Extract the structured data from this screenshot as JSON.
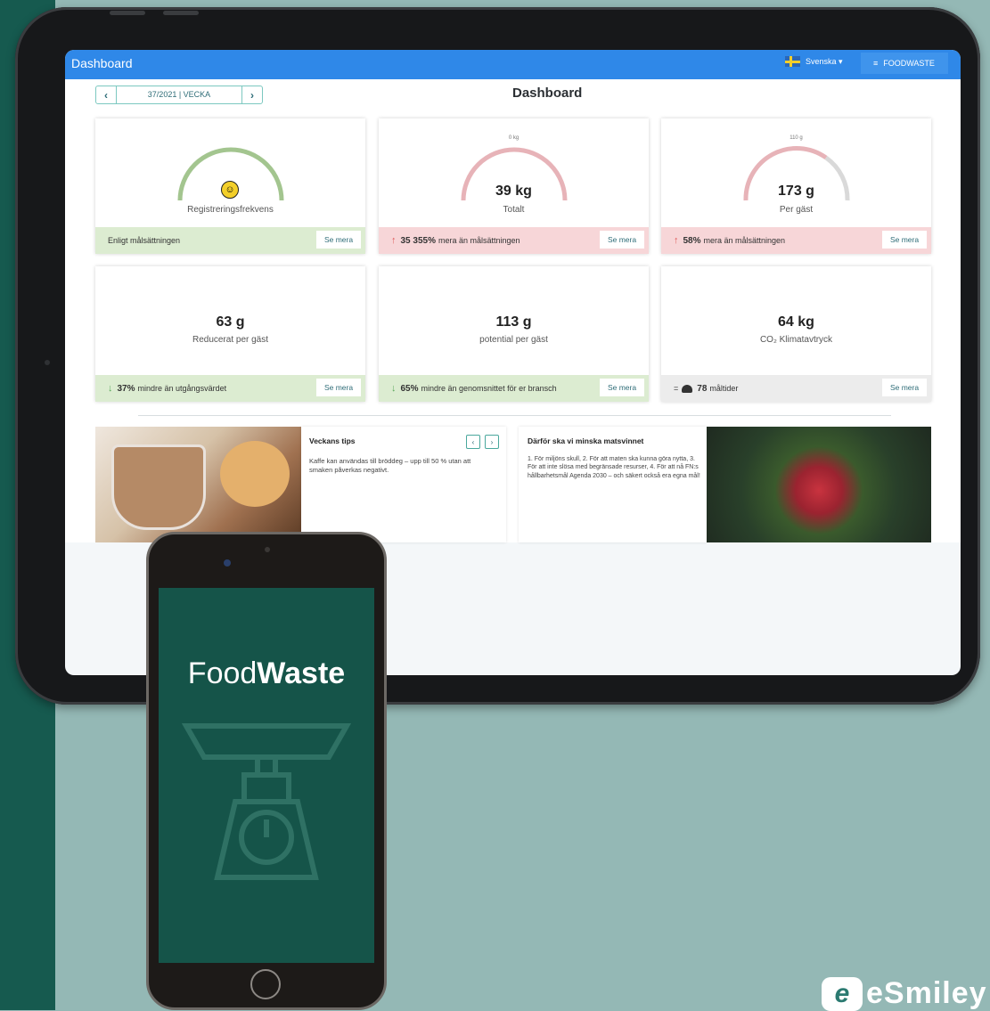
{
  "topbar": {
    "app_title": "Dashboard",
    "language": "Svenska ▾",
    "menu_label": "FOODWASTE"
  },
  "week_nav": {
    "prev": "‹",
    "label": "37/2021 | VECKA",
    "next": "›"
  },
  "page_title": "Dashboard",
  "cards": [
    {
      "value": "",
      "label": "Registreringsfrekvens",
      "gauge_tick": "",
      "footer_bold": "",
      "footer_text": "Enligt målsättningen",
      "more": "Se mera",
      "status": "green",
      "gauge_color": "#a3c58f"
    },
    {
      "value": "39 kg",
      "label": "Totalt",
      "gauge_tick": "0 kg",
      "footer_bold": "35 355%",
      "footer_text": "mera än målsättningen",
      "more": "Se mera",
      "status": "red",
      "gauge_color": "#e7b3b8"
    },
    {
      "value": "173 g",
      "label": "Per gäst",
      "gauge_tick": "110 g",
      "footer_bold": "58%",
      "footer_text": "mera än målsättningen",
      "more": "Se mera",
      "status": "red",
      "gauge_color": "#e7b3b8"
    },
    {
      "value": "63 g",
      "label": "Reducerat per gäst",
      "footer_bold": "37%",
      "footer_text": "mindre än utgångsvärdet",
      "more": "Se mera",
      "status": "green"
    },
    {
      "value": "113 g",
      "label": "potential per gäst",
      "footer_bold": "65%",
      "footer_text": "mindre än genomsnittet för er bransch",
      "more": "Se mera",
      "status": "green"
    },
    {
      "value": "64 kg",
      "label": "CO₂ Klimatavtryck",
      "footer_prefix": "=",
      "footer_bold": "78",
      "footer_text": "måltider",
      "more": "Se mera",
      "status": "gray"
    }
  ],
  "tips": {
    "title": "Veckans tips",
    "text": "Kaffe kan användas till bröddeg – upp till 50 % utan att smaken påverkas negativt."
  },
  "why": {
    "title": "Därför ska vi minska matsvinnet",
    "text": "1. För miljöns skull, 2. För att maten ska kunna göra nytta, 3. För att inte slösa med begränsade resurser, 4. För att nå FN:s hållbarhetsmål Agenda 2030 – och säkert också era egna mål!"
  },
  "phone": {
    "brand_regular": "Food",
    "brand_bold": "Waste"
  },
  "footer_logo": {
    "mark": "e",
    "word": "eSmiley"
  },
  "colors": {
    "accent": "#2f88e8",
    "brand_green": "#165a4f",
    "positive_bg": "#dcecd1",
    "negative_bg": "#f7d6d8"
  }
}
